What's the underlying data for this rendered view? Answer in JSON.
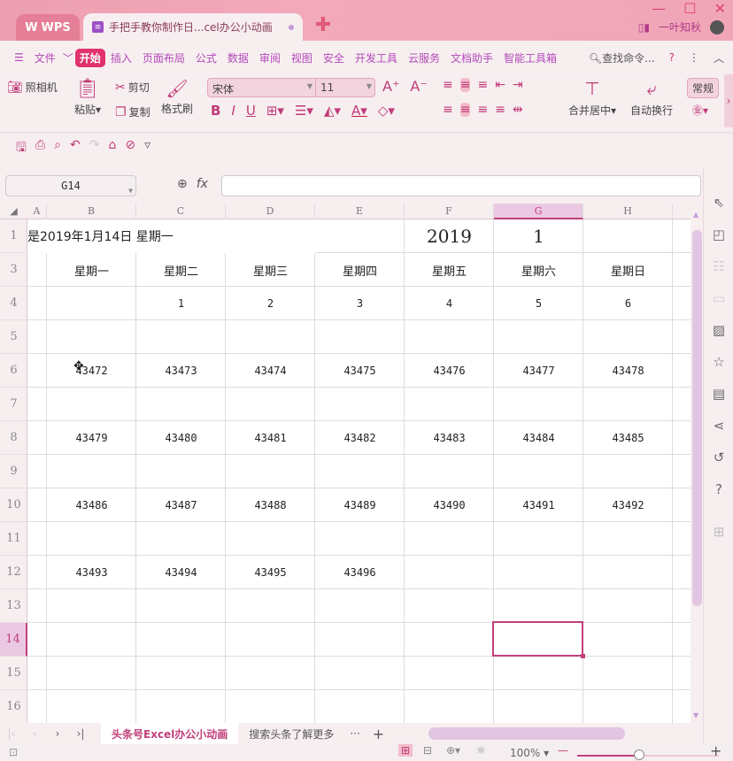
{
  "titlebar": {
    "app_name": "WPS",
    "doc_tab_title": "手把手教你制作日...cel办公小动画",
    "user_name": "一叶知秋",
    "window_controls": [
      "minimize",
      "maximize",
      "close"
    ]
  },
  "menubar": {
    "items": [
      "文件",
      "开始",
      "插入",
      "页面布局",
      "公式",
      "数据",
      "审阅",
      "视图",
      "安全",
      "开发工具",
      "云服务",
      "文档助手",
      "智能工具箱"
    ],
    "active": "开始",
    "search_label": "查找命令..."
  },
  "ribbon": {
    "camera": "照相机",
    "paste": "粘贴",
    "cut": "剪切",
    "copy": "复制",
    "format_painter": "格式刷",
    "font_name": "宋体",
    "font_size": "11",
    "merge_center": "合并居中",
    "wrap_text": "自动换行",
    "number_format": "常规"
  },
  "formula_bar": {
    "name_box": "G14",
    "fx_label": "fx",
    "formula_value": ""
  },
  "sheet": {
    "columns": [
      "A",
      "B",
      "C",
      "D",
      "E",
      "F",
      "G",
      "H"
    ],
    "selected_column": "G",
    "rows": [
      "1",
      "3",
      "4",
      "5",
      "6",
      "7",
      "8",
      "9",
      "10",
      "11",
      "12",
      "13",
      "14",
      "15",
      "16"
    ],
    "selected_row": "14",
    "selected_cell": "G14",
    "row1": {
      "label": "是2019年1月14日  星期一",
      "year": "2019",
      "month": "1"
    },
    "weekdays": [
      "星期一",
      "星期二",
      "星期三",
      "星期四",
      "星期五",
      "星期六",
      "星期日"
    ],
    "row4": [
      "",
      "1",
      "2",
      "3",
      "4",
      "5",
      "6"
    ],
    "row6": [
      "43472",
      "43473",
      "43474",
      "43475",
      "43476",
      "43477",
      "43478"
    ],
    "row8": [
      "43479",
      "43480",
      "43481",
      "43482",
      "43483",
      "43484",
      "43485"
    ],
    "row10": [
      "43486",
      "43487",
      "43488",
      "43489",
      "43490",
      "43491",
      "43492"
    ],
    "row12": [
      "43493",
      "43494",
      "43495",
      "43496",
      "",
      "",
      ""
    ]
  },
  "sheet_tabs": {
    "tabs": [
      "头条号Excel办公小动画",
      "搜索头条了解更多"
    ],
    "active": "头条号Excel办公小动画",
    "more": "···",
    "add": "+"
  },
  "statusbar": {
    "zoom_level": "100%",
    "zoom_fraction": 0.5
  },
  "colors": {
    "accent": "#c1407a",
    "active_menu": "#e0336d",
    "menu_text": "#b24ab8",
    "scroll_thumb": "#e2c5e3"
  }
}
